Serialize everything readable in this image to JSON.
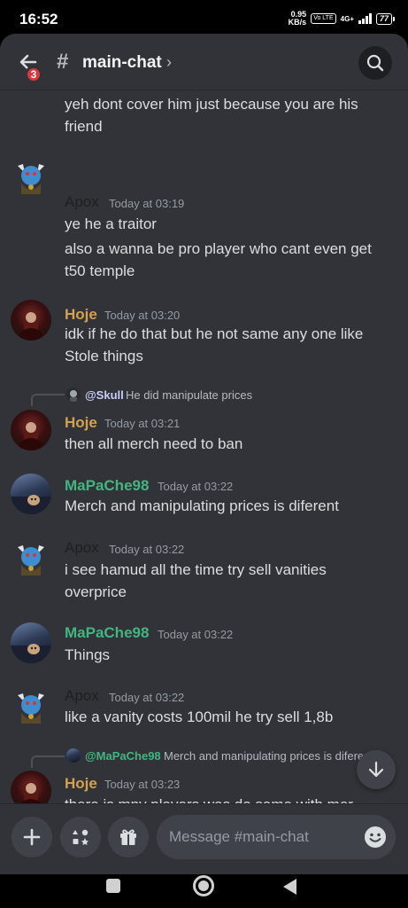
{
  "status_bar": {
    "time": "16:52",
    "net_speed_value": "0.95",
    "net_speed_unit": "KB/s",
    "volte": "Vo LTE",
    "net_type": "4G+",
    "battery": "77"
  },
  "header": {
    "back_badge": "3",
    "channel_prefix": "#",
    "channel_name": "main-chat",
    "chevron": "›"
  },
  "colors": {
    "apox": "#1e1f22",
    "hoje": "#d6a14f",
    "mapache": "#43b581",
    "mention": "#c9cdfb"
  },
  "messages": [
    {
      "text": "yeh dont cover him just because you are his"
    },
    {
      "text": "friend"
    },
    {
      "author": "Apox",
      "time": "Today at 03:19",
      "text": "ye he a traitor"
    },
    {
      "text": "also a wanna be pro player who cant even get"
    },
    {
      "text": "t50 temple"
    },
    {
      "author": "Hoje",
      "time": "Today at 03:20",
      "text": "idk if he do that but he not same any one like"
    },
    {
      "text": "Stole things"
    },
    {
      "reply_author": "@Skull",
      "reply_text": "He did manipulate prices"
    },
    {
      "author": "Hoje",
      "time": "Today at 03:21",
      "text": "then all merch need to ban"
    },
    {
      "author": "MaPaChe98",
      "time": "Today at 03:22",
      "text": "Merch and manipulating prices is diferent"
    },
    {
      "author": "Apox",
      "time": "Today at 03:22",
      "text": "i see hamud all the time try sell vanities"
    },
    {
      "text": "overprice"
    },
    {
      "author": "MaPaChe98",
      "time": "Today at 03:22",
      "text": "Things"
    },
    {
      "author": "Apox",
      "time": "Today at 03:22",
      "text": "like a vanity costs 100mil he try sell 1,8b"
    },
    {
      "reply_author": "@MaPaChe98",
      "reply_text": "Merch and manipulating prices is diferent"
    },
    {
      "author": "Hoje",
      "time": "Today at 03:23",
      "text": "there is mny players was do same with mer"
    }
  ],
  "composer": {
    "placeholder": "Message #main-chat"
  }
}
